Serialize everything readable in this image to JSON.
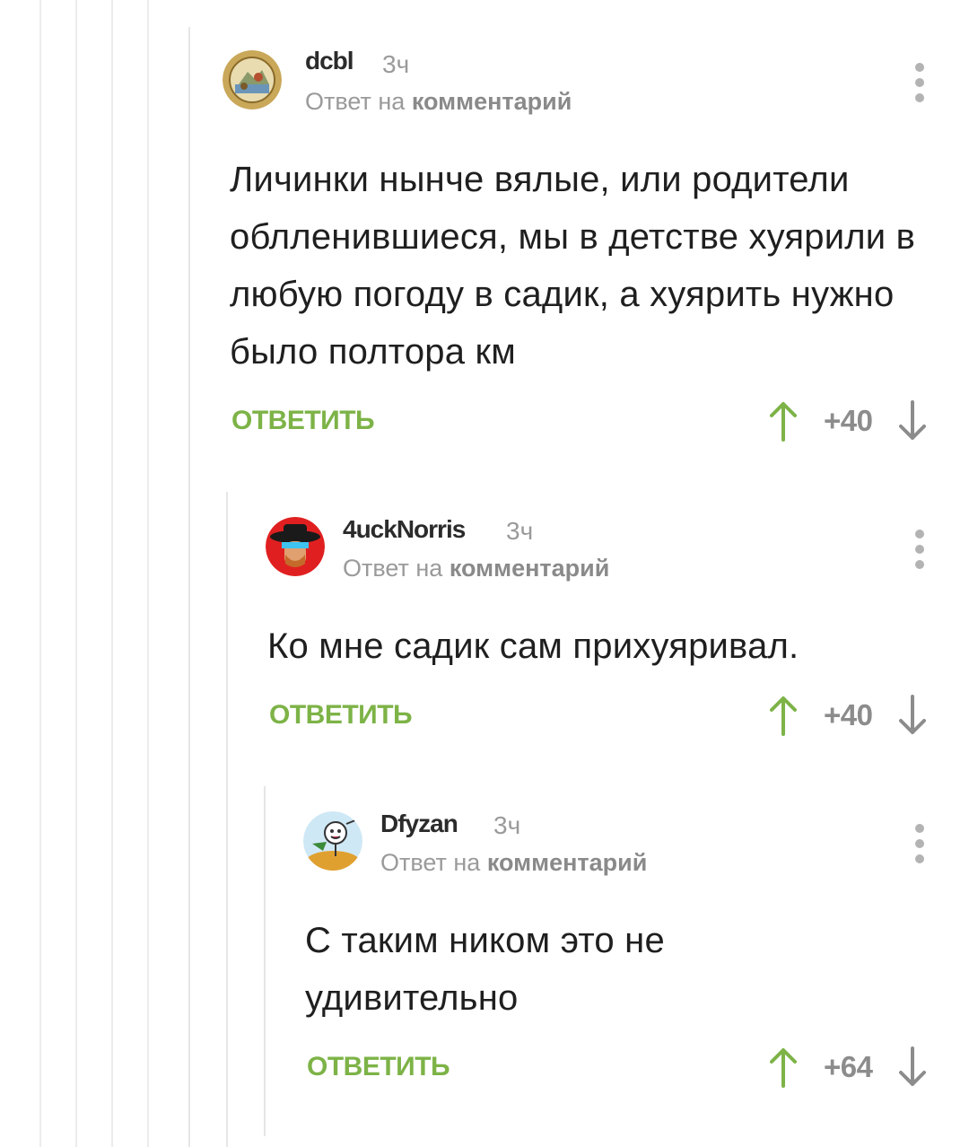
{
  "colors": {
    "accent_green": "#7db347",
    "muted_text": "#9a9a9a",
    "thread_line": "#ececec"
  },
  "comments": [
    {
      "username": "dcbl",
      "time": "3ч",
      "reply_prefix": "Ответ на",
      "reply_link": "комментарий",
      "body": "Личинки нынче вялые, или родители облленившиеся, мы в детстве хуярили в любую погоду в садик, а хуярить нужно было полтора км",
      "reply_button": "ОТВЕТИТЬ",
      "rating": "+40",
      "avatar_icon": "state-seal-avatar"
    },
    {
      "username": "4uckNorris",
      "time": "3ч",
      "reply_prefix": "Ответ на",
      "reply_link": "комментарий",
      "body": "Ко мне садик сам прихуяривал.",
      "reply_button": "ОТВЕТИТЬ",
      "rating": "+40",
      "avatar_icon": "cowboy-hat-avatar"
    },
    {
      "username": "Dfyzan",
      "time": "3ч",
      "reply_prefix": "Ответ на",
      "reply_link": "комментарий",
      "body": "С таким ником это не удивительно",
      "reply_button": "ОТВЕТИТЬ",
      "rating": "+64",
      "avatar_icon": "cartoon-character-avatar"
    }
  ]
}
